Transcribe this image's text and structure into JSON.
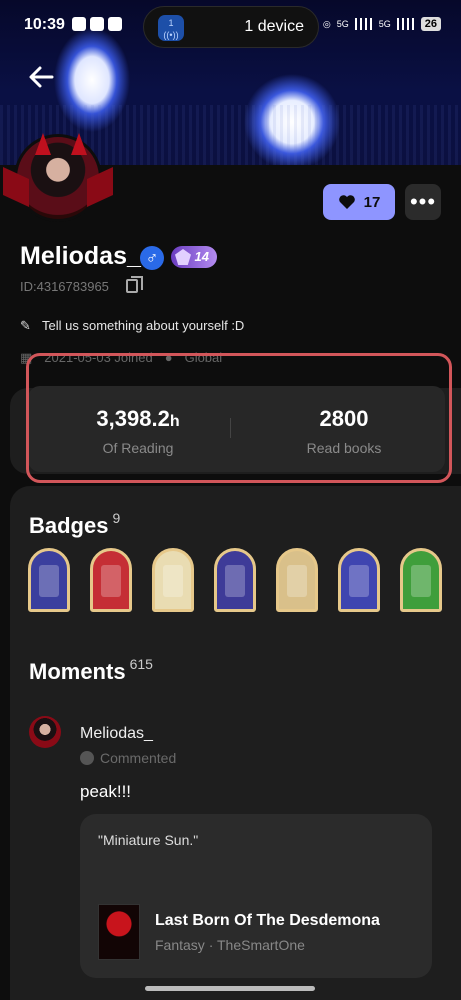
{
  "status_bar": {
    "time": "10:39",
    "island_text": "1 device",
    "battery": "26",
    "network": "5G"
  },
  "profile": {
    "username": "Meliodas_",
    "gender_symbol": "♂",
    "level": "14",
    "id": "ID:4316783965",
    "bio": "Tell us something about yourself :D",
    "joined": "2021-05-03 Joined",
    "location": "Global",
    "like_count": "17"
  },
  "stats": {
    "reading_value": "3,398.2",
    "reading_unit": "h",
    "reading_label": "Of Reading",
    "books_value": "2800",
    "books_label": "Read books"
  },
  "badges": {
    "title": "Badges",
    "count": "9",
    "colors": [
      "#3b3f9e",
      "#c52e35",
      "#e9dcb2",
      "#3e3b98",
      "#d9c08a",
      "#3f45b0",
      "#3f9e3b"
    ]
  },
  "moments": {
    "title": "Moments",
    "count": "615",
    "post": {
      "user": "Meliodas_",
      "action": "Commented",
      "text": "peak!!!",
      "quote": "\"Miniature Sun.\"",
      "book_title": "Last Born Of The Desdemona",
      "book_meta": "Fantasy · TheSmartOne"
    }
  },
  "colors": {
    "accent": "#8e95ff",
    "highlight": "#d2565a",
    "card": "#272727"
  }
}
